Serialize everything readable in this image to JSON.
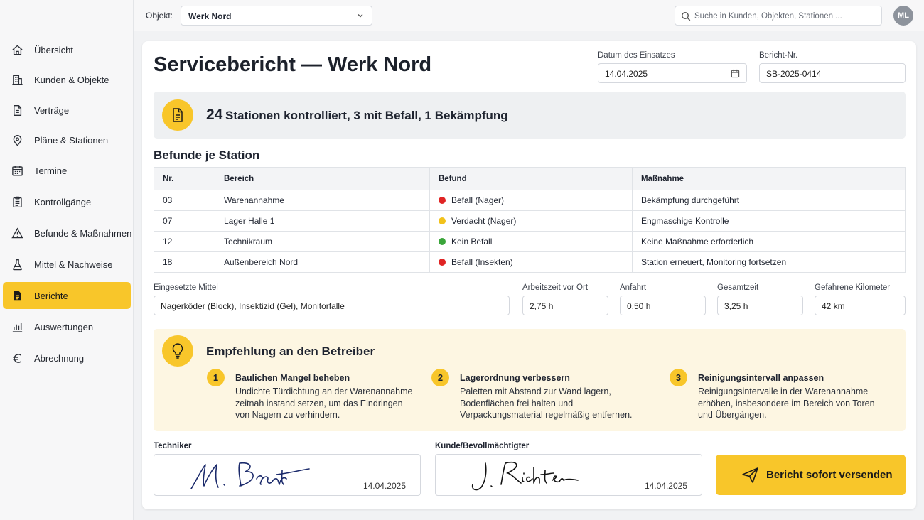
{
  "topbar": {
    "objekt_label": "Objekt:",
    "objekt_value": "Werk Nord",
    "search_placeholder": "Suche in Kunden, Objekten, Stationen ...",
    "avatar_initials": "ML"
  },
  "sidebar": {
    "items": [
      {
        "label": "Übersicht",
        "icon": "home-icon"
      },
      {
        "label": "Kunden & Objekte",
        "icon": "building-icon"
      },
      {
        "label": "Verträge",
        "icon": "document-icon"
      },
      {
        "label": "Pläne & Stationen",
        "icon": "map-pin-icon"
      },
      {
        "label": "Termine",
        "icon": "calendar-icon"
      },
      {
        "label": "Kontrollgänge",
        "icon": "clipboard-icon"
      },
      {
        "label": "Befunde & Maßnahmen",
        "icon": "warning-icon"
      },
      {
        "label": "Mittel & Nachweise",
        "icon": "flask-icon"
      },
      {
        "label": "Berichte",
        "icon": "report-icon",
        "active": true
      },
      {
        "label": "Auswertungen",
        "icon": "bar-chart-icon"
      },
      {
        "label": "Abrechnung",
        "icon": "euro-icon"
      }
    ]
  },
  "report": {
    "title": "Servicebericht — Werk Nord",
    "date_label": "Datum des Einsatzes",
    "date_value": "14.04.2025",
    "number_label": "Bericht-Nr.",
    "number_value": "SB-2025-0414",
    "summary_count": "24",
    "summary_text": "Stationen kontrolliert, 3 mit Befall, 1 Bekämpfung",
    "section_title": "Befunde je Station",
    "table": {
      "headers": [
        "Nr.",
        "Bereich",
        "Befund",
        "Maßnahme"
      ],
      "rows": [
        {
          "nr": "03",
          "bereich": "Warenannahme",
          "befund": "Befall (Nager)",
          "status_color": "#e02424",
          "massnahme": "Bekämpfung durchgeführt"
        },
        {
          "nr": "07",
          "bereich": "Lager Halle 1",
          "befund": "Verdacht (Nager)",
          "status_color": "#f2c21b",
          "massnahme": "Engmaschige Kontrolle"
        },
        {
          "nr": "12",
          "bereich": "Technikraum",
          "befund": "Kein Befall",
          "status_color": "#3aa53a",
          "massnahme": "Keine Maßnahme erforderlich"
        },
        {
          "nr": "18",
          "bereich": "Außenbereich Nord",
          "befund": "Befall (Insekten)",
          "status_color": "#e02424",
          "massnahme": "Station erneuert, Monitoring fortsetzen"
        }
      ]
    },
    "mittel_label": "Eingesetzte Mittel",
    "mittel_value": "Nagerköder (Block), Insektizid (Gel), Monitorfalle",
    "arbeitszeit_label": "Arbeitszeit vor Ort",
    "arbeitszeit_value": "2,75 h",
    "anfahrt_label": "Anfahrt",
    "anfahrt_value": "0,50 h",
    "gesamtzeit_label": "Gesamtzeit",
    "gesamtzeit_value": "3,25 h",
    "km_label": "Gefahrene Kilometer",
    "km_value": "42 km",
    "recommendation": {
      "title": "Empfehlung an den Betreiber",
      "steps": [
        {
          "num": "1",
          "title": "Baulichen Mangel beheben",
          "text": "Undichte Türdichtung an der Warenannahme zeitnah instand setzen, um das Eindringen von Nagern zu verhindern."
        },
        {
          "num": "2",
          "title": "Lagerordnung verbessern",
          "text": "Paletten mit Abstand zur Wand lagern, Bodenflächen frei halten und Verpackungsmaterial regelmäßig entfernen."
        },
        {
          "num": "3",
          "title": "Reinigungsintervall anpassen",
          "text": "Reinigungsintervalle in der Warenannahme erhöhen, insbesondere im Bereich von Toren und Übergängen."
        }
      ]
    },
    "techniker_label": "Techniker",
    "techniker_signature": "M. Brandt",
    "techniker_date": "14.04.2025",
    "kunde_label": "Kunde/Bevollmächtigter",
    "kunde_signature": "J. Richter",
    "kunde_date": "14.04.2025",
    "send_button": "Bericht sofort versenden"
  },
  "colors": {
    "accent": "#f8c62a",
    "recommendation_bg": "#fdf6e2",
    "status_red": "#e02424",
    "status_yellow": "#f2c21b",
    "status_green": "#3aa53a"
  }
}
